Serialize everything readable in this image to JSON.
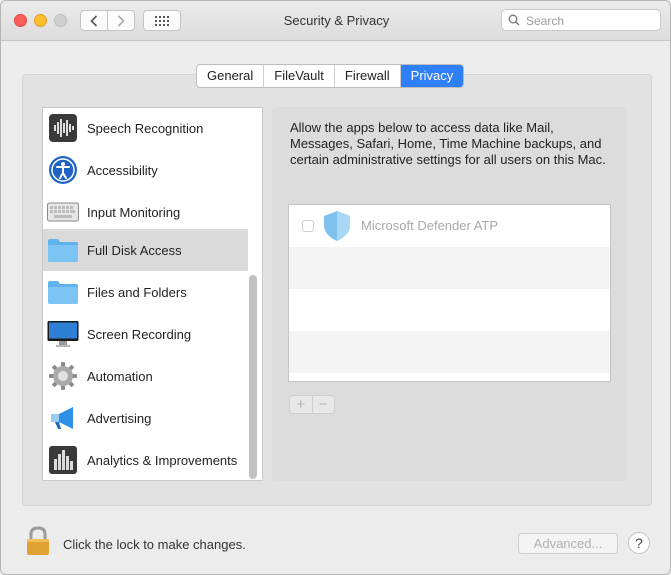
{
  "window": {
    "title": "Security & Privacy"
  },
  "toolbar": {
    "back_icon": "chevron-left-icon",
    "forward_icon": "chevron-right-icon",
    "grid_icon": "show-all-grid-icon"
  },
  "search": {
    "placeholder": "Search"
  },
  "tabs": [
    {
      "label": "General",
      "active": false
    },
    {
      "label": "FileVault",
      "active": false
    },
    {
      "label": "Firewall",
      "active": false
    },
    {
      "label": "Privacy",
      "active": true
    }
  ],
  "accent_color": "#2f7ff6",
  "categories": [
    {
      "label": "Speech Recognition",
      "icon": "speech-waveform-icon",
      "selected": false
    },
    {
      "label": "Accessibility",
      "icon": "accessibility-icon",
      "selected": false
    },
    {
      "label": "Input Monitoring",
      "icon": "keyboard-icon",
      "selected": false
    },
    {
      "label": "Full Disk Access",
      "icon": "folder-icon",
      "selected": true
    },
    {
      "label": "Files and Folders",
      "icon": "folder-icon",
      "selected": false
    },
    {
      "label": "Screen Recording",
      "icon": "display-icon",
      "selected": false
    },
    {
      "label": "Automation",
      "icon": "gear-icon",
      "selected": false
    },
    {
      "label": "Advertising",
      "icon": "megaphone-icon",
      "selected": false
    },
    {
      "label": "Analytics & Improvements",
      "icon": "bar-chart-icon",
      "selected": false
    }
  ],
  "detail": {
    "description": "Allow the apps below to access data like Mail, Messages, Safari, Home, Time Machine backups, and certain administrative settings for all users on this Mac.",
    "apps": [
      {
        "name": "Microsoft Defender ATP",
        "checked": false,
        "icon": "defender-shield-icon"
      }
    ],
    "add_label": "+",
    "remove_label": "−"
  },
  "footer": {
    "lock_text": "Click the lock to make changes.",
    "advanced_label": "Advanced...",
    "help_label": "?"
  }
}
